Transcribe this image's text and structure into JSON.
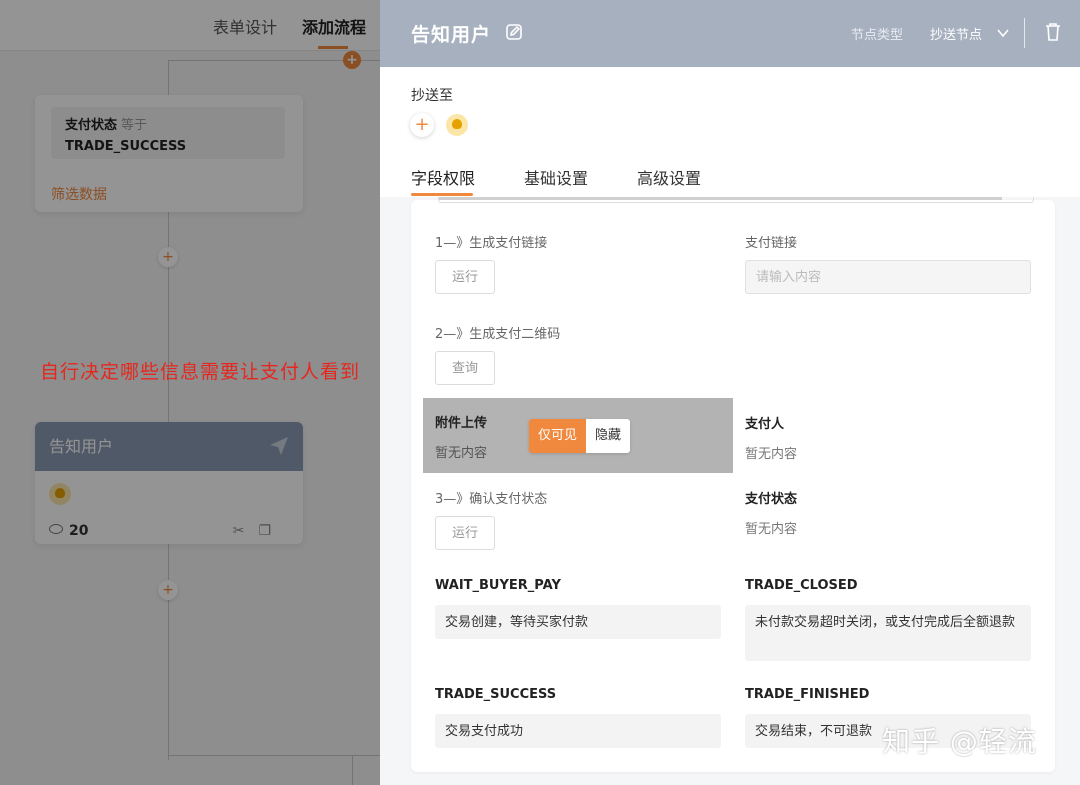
{
  "canvas": {
    "tabs": [
      {
        "label": "表单设计",
        "active": false
      },
      {
        "label": "添加流程",
        "active": true
      }
    ],
    "condition_card": {
      "field": "支付状态",
      "operator": "等于",
      "value": "TRADE_SUCCESS",
      "filter_link": "筛选数据"
    },
    "notify_card": {
      "title": "告知用户",
      "view_count": "20"
    },
    "annotation": "自行决定哪些信息需要让支付人看到"
  },
  "drawer": {
    "title": "告知用户",
    "node_type_label": "节点类型",
    "node_type_value": "抄送节点",
    "cc_label": "抄送至",
    "tabs": [
      {
        "label": "字段权限",
        "active": true
      },
      {
        "label": "基础设置",
        "active": false
      },
      {
        "label": "高级设置",
        "active": false
      }
    ],
    "fields": {
      "step1_label": "1—》生成支付链接",
      "step1_button": "运行",
      "pay_link_label": "支付链接",
      "pay_link_placeholder": "请输入内容",
      "step2_label": "2—》生成支付二维码",
      "step2_button": "查询",
      "attachment_label": "附件上传",
      "attachment_empty": "暂无内容",
      "visibility_options": [
        "仅可见",
        "隐藏"
      ],
      "visibility_selected": "仅可见",
      "payer_label": "支付人",
      "payer_empty": "暂无内容",
      "step3_label": "3—》确认支付状态",
      "step3_button": "运行",
      "pay_status_label": "支付状态",
      "pay_status_empty": "暂无内容"
    },
    "status_descriptions": [
      {
        "code": "WAIT_BUYER_PAY",
        "desc": "交易创建，等待买家付款"
      },
      {
        "code": "TRADE_CLOSED",
        "desc": "未付款交易超时关闭，或支付完成后全额退款"
      },
      {
        "code": "TRADE_SUCCESS",
        "desc": "交易支付成功"
      },
      {
        "code": "TRADE_FINISHED",
        "desc": "交易结束，不可退款"
      }
    ]
  },
  "watermark": "知乎 @轻流",
  "colors": {
    "accent": "#f0883e",
    "header": "#a6b0bf",
    "annotation": "#e5281f"
  }
}
